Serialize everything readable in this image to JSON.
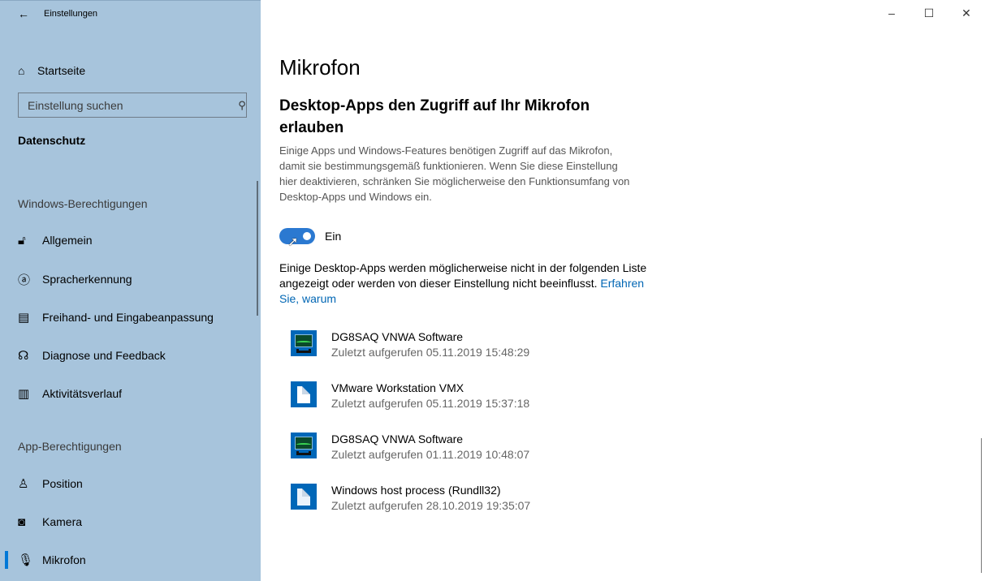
{
  "window": {
    "title": "Einstellungen",
    "minimize_glyph": "–",
    "maximize_glyph": "☐",
    "close_glyph": "✕"
  },
  "sidebar": {
    "home_label": "Startseite",
    "search_placeholder": "Einstellung suchen",
    "section_title": "Datenschutz",
    "group_windows": "Windows-Berechtigungen",
    "windows_items": [
      {
        "label": "Allgemein",
        "icon": "lock-icon"
      },
      {
        "label": "Spracherkennung",
        "icon": "speech-icon"
      },
      {
        "label": "Freihand- und Eingabeanpassung",
        "icon": "clipboard-icon"
      },
      {
        "label": "Diagnose und Feedback",
        "icon": "feedback-icon"
      },
      {
        "label": "Aktivitätsverlauf",
        "icon": "timeline-icon"
      }
    ],
    "group_apps": "App-Berechtigungen",
    "app_items": [
      {
        "label": "Position",
        "icon": "location-icon"
      },
      {
        "label": "Kamera",
        "icon": "camera-icon"
      },
      {
        "label": "Mikrofon",
        "icon": "microphone-icon",
        "active": true
      }
    ]
  },
  "content": {
    "page_title": "Mikrofon",
    "section_title": "Desktop-Apps den Zugriff auf Ihr Mikrofon erlauben",
    "description": "Einige Apps und Windows-Features benötigen Zugriff auf das Mikrofon, damit sie bestimmungsgemäß funktionieren. Wenn Sie diese Einstellung hier deaktivieren, schränken Sie möglicherweise den Funktionsumfang von Desktop-Apps und Windows ein.",
    "toggle": {
      "state": "on",
      "label": "Ein"
    },
    "note_text": "Einige Desktop-Apps werden möglicherweise nicht in der folgenden Liste angezeigt oder werden von dieser Einstellung nicht beeinflusst.",
    "note_link": "Erfahren Sie, warum",
    "apps": [
      {
        "name": "DG8SAQ VNWA Software",
        "last_access": "Zuletzt aufgerufen 05.11.2019 15:48:29",
        "icon": "vnwa-icon"
      },
      {
        "name": "VMware Workstation VMX",
        "last_access": "Zuletzt aufgerufen 05.11.2019 15:37:18",
        "icon": "file-icon"
      },
      {
        "name": "DG8SAQ VNWA Software",
        "last_access": "Zuletzt aufgerufen 01.11.2019 10:48:07",
        "icon": "vnwa-icon"
      },
      {
        "name": "Windows host process (Rundll32)",
        "last_access": "Zuletzt aufgerufen 28.10.2019 19:35:07",
        "icon": "file-icon"
      }
    ]
  },
  "colors": {
    "sidebar_bg": "#a7c4dc",
    "accent": "#0078d7",
    "toggle_on": "#2b79d1",
    "link": "#0066b4"
  }
}
